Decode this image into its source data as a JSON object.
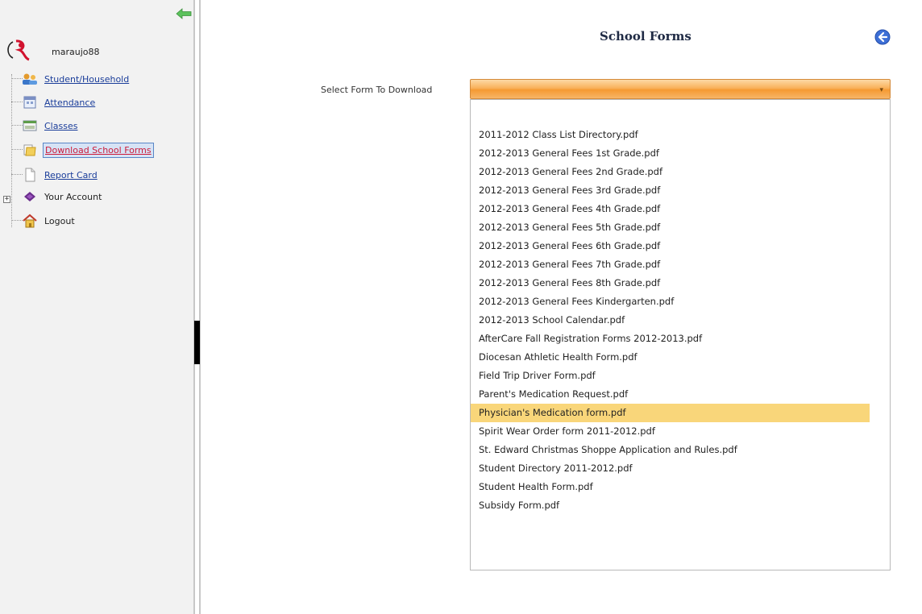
{
  "user": {
    "name": "maraujo88"
  },
  "nav": {
    "items": [
      {
        "label": "Student/Household",
        "icon": "household-icon",
        "link": true,
        "selected": false
      },
      {
        "label": "Attendance",
        "icon": "calendar-icon",
        "link": true,
        "selected": false
      },
      {
        "label": "Classes",
        "icon": "classes-icon",
        "link": true,
        "selected": false
      },
      {
        "label": "Download School Forms",
        "icon": "folder-icon",
        "link": true,
        "selected": true
      },
      {
        "label": "Report Card",
        "icon": "document-icon",
        "link": true,
        "selected": false
      },
      {
        "label": "Your Account",
        "icon": "account-icon",
        "link": false,
        "selected": false,
        "expandable": true,
        "expand_glyph": "+"
      },
      {
        "label": "Logout",
        "icon": "home-icon",
        "link": false,
        "selected": false
      }
    ]
  },
  "page": {
    "title": "School Forms",
    "form_label": "Select Form To Download",
    "select_value": "",
    "arrow_glyph": "▾"
  },
  "forms": {
    "highlighted_index": 16,
    "options": [
      "2011-2012 Class List Directory.pdf",
      "2012-2013 General Fees 1st Grade.pdf",
      "2012-2013 General Fees 2nd Grade.pdf",
      "2012-2013 General Fees 3rd Grade.pdf",
      "2012-2013 General Fees 4th Grade.pdf",
      "2012-2013 General Fees 5th Grade.pdf",
      "2012-2013 General Fees 6th Grade.pdf",
      "2012-2013 General Fees 7th Grade.pdf",
      "2012-2013 General Fees 8th Grade.pdf",
      "2012-2013 General Fees Kindergarten.pdf",
      "2012-2013 School Calendar.pdf",
      "AfterCare Fall Registration Forms 2012-2013.pdf",
      "Diocesan Athletic Health Form.pdf",
      "Field Trip Driver Form.pdf",
      "Parent's Medication Request.pdf",
      "Physician's Medication form.pdf",
      "Spirit Wear Order form 2011-2012.pdf",
      "St. Edward Christmas Shoppe Application and Rules.pdf",
      "Student Directory 2011-2012.pdf",
      "Student Health Form.pdf",
      "Subsidy Form.pdf"
    ]
  },
  "colors": {
    "link": "#1a3d9a",
    "selected_link": "#cc1b3a",
    "select_orange": "#f59a32",
    "highlight": "#f9d67a",
    "back_button": "#3d6fd6",
    "collapse_arrow": "#4caf50"
  }
}
